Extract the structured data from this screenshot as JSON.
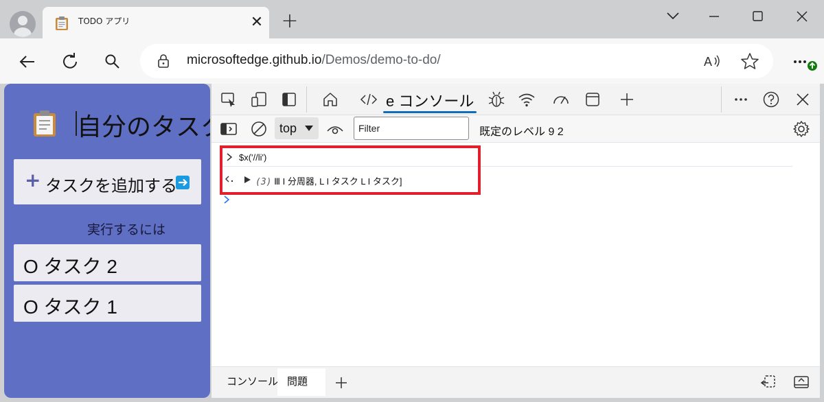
{
  "browser": {
    "tab_title": "TODO アプリ",
    "url_host": "microsoftedge.github.io",
    "url_path": "/Demos/demo-to-do/"
  },
  "app": {
    "heading": "自分のタスク",
    "add_button_label": "タスクを追加する",
    "todo_section_label": "実行するには",
    "tasks": [
      "O タスク 2",
      "O タスク 1"
    ]
  },
  "devtools": {
    "active_tool_tab": "e コンソール",
    "context_selector": "top",
    "filter_value": "Filter",
    "levels_label": "既定のレベル 9 2",
    "console_input": "$x('//li')",
    "console_result_count": "(3)",
    "console_result_text": " Ⅲ I 分周器,           L I タスク        L I タスク]",
    "bottom_tabs": [
      "コンソール",
      "問題"
    ]
  },
  "colors": {
    "app_panel": "#5f6fc4",
    "highlight_box": "#e0202c",
    "active_tab_underline": "#0f6cbd"
  }
}
